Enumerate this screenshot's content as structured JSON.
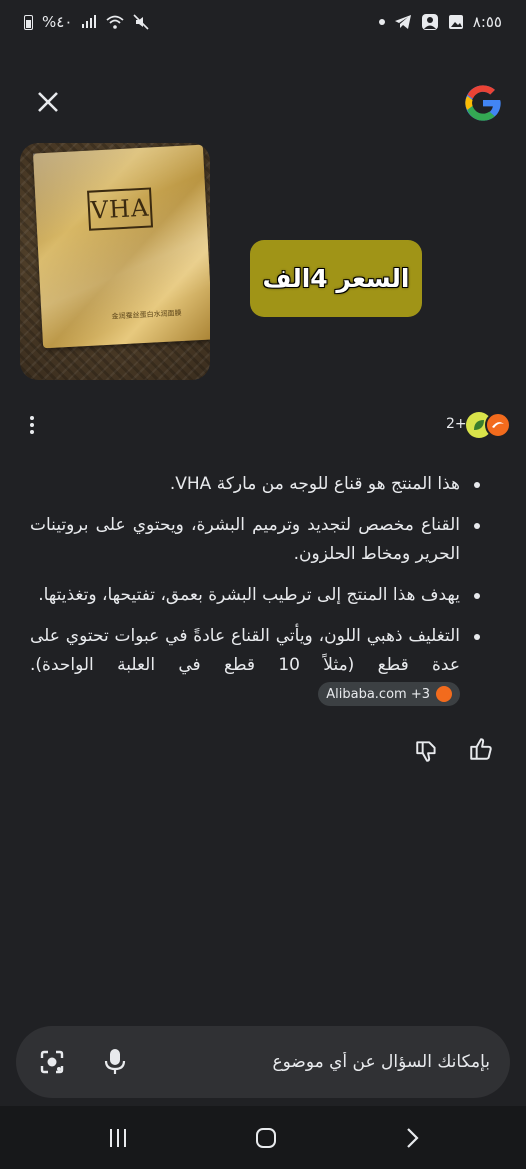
{
  "status_bar": {
    "time": "٨:٥٥",
    "battery": "%٤٠"
  },
  "header": {
    "close_icon": "close-icon",
    "logo": "google-logo"
  },
  "result": {
    "image_brand": "VHA",
    "image_subtext": "金润蚕丝蛋白水润面膜",
    "price_label": "السعر 4الف",
    "sources_count": "2+"
  },
  "answer": {
    "bullets": [
      "هذا المنتج هو قناع للوجه من ماركة VHA.",
      "القناع مخصص لتجديد وترميم البشرة، ويحتوي على بروتينات الحرير ومخاط الحلزون.",
      "يهدف هذا المنتج إلى ترطيب البشرة بعمق، تفتيحها، وتغذيتها.",
      "التغليف ذهبي اللون، ويأتي القناع عادةً في عبوات تحتوي على عدة قطع (مثلاً 10 قطع في العلبة الواحدة)."
    ],
    "source_chip": "Alibaba.com +3"
  },
  "feedback": {
    "thumbs_up": "thumbs-up-icon",
    "thumbs_down": "thumbs-down-icon"
  },
  "ask": {
    "placeholder": "بإمكانك السؤال عن أي موضوع"
  },
  "colors": {
    "background": "#202124",
    "price_tag": "#a09417",
    "input_bg": "#303134"
  }
}
